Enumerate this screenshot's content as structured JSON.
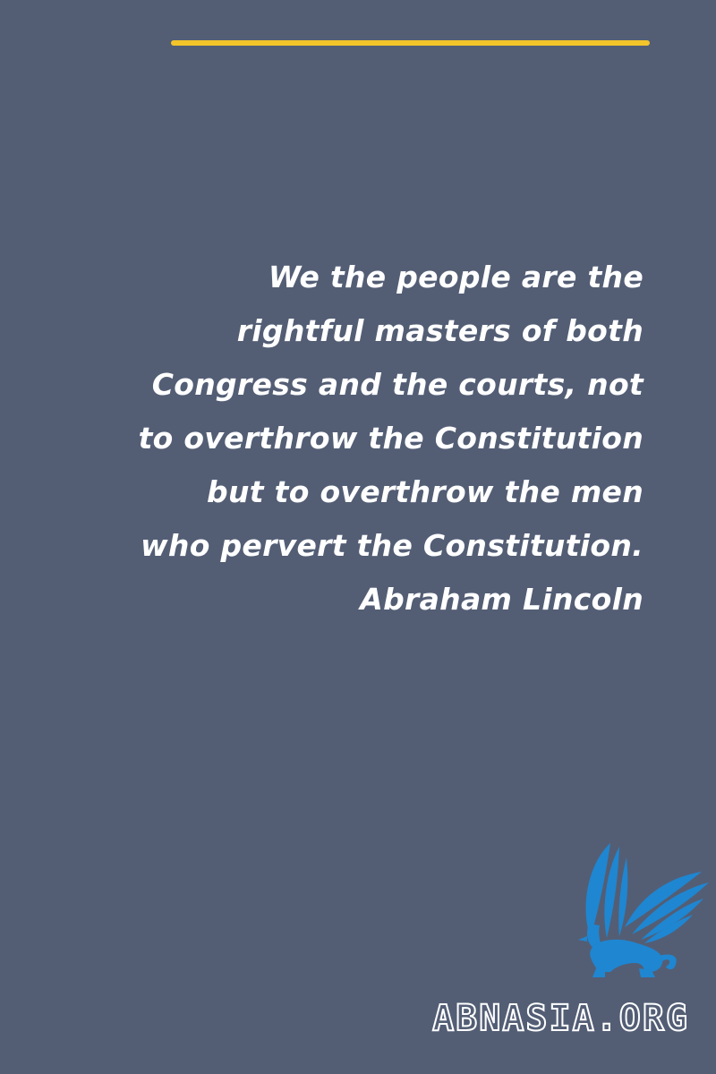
{
  "quote": {
    "lines": [
      "We the people are the",
      "rightful masters of both",
      "Congress and the courts, not",
      "to overthrow the Constitution",
      "but to overthrow the men",
      "who pervert the Constitution."
    ],
    "author": "Abraham Lincoln"
  },
  "brand": {
    "text": "ABNASIA.ORG",
    "logo_icon": "griffin-logo-icon"
  },
  "colors": {
    "background": "#535e75",
    "accent": "#f4c52a",
    "text": "#ffffff",
    "logo": "#1f86d1"
  }
}
